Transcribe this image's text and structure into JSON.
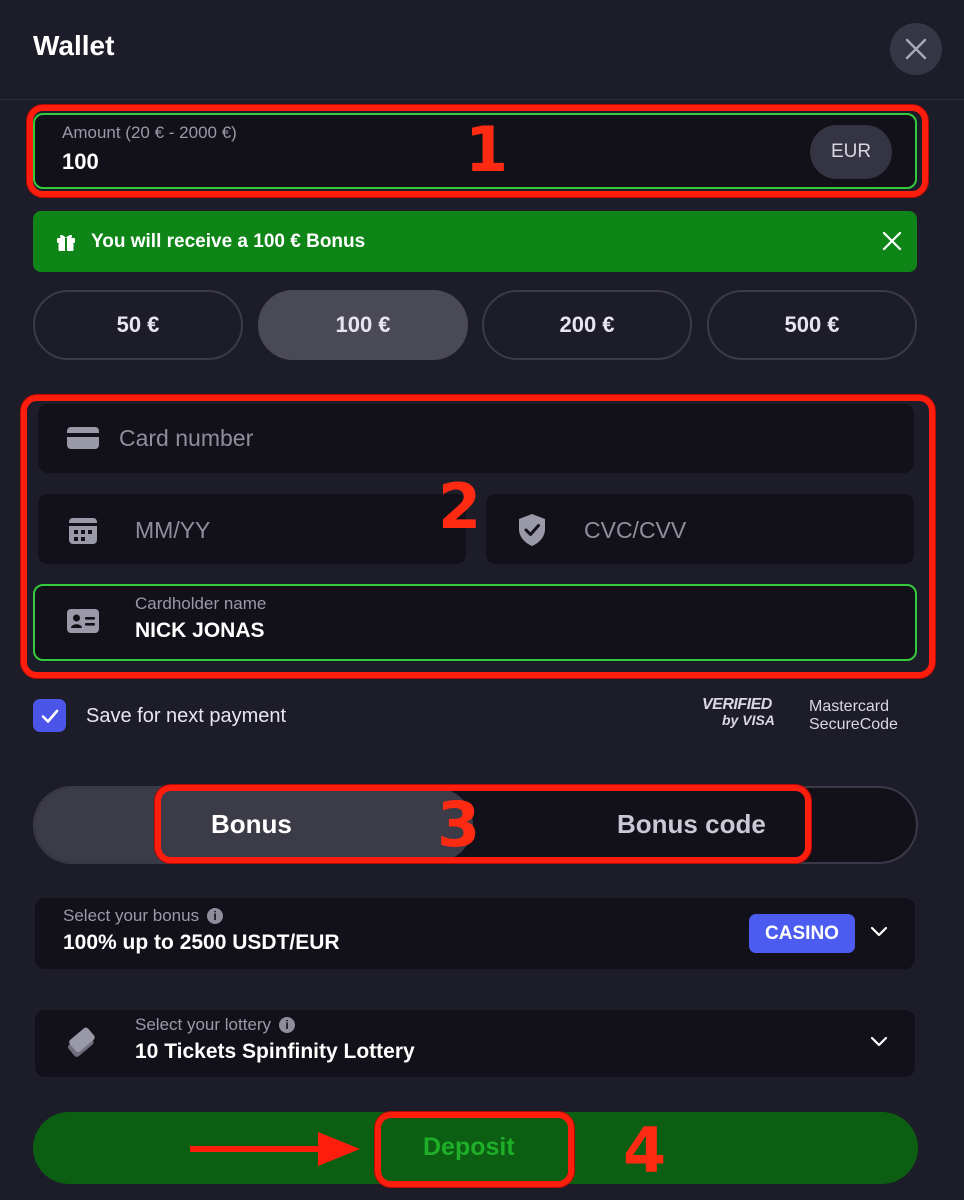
{
  "header": {
    "title": "Wallet"
  },
  "amount": {
    "label": "Amount (20 € - 2000 €)",
    "value": "100",
    "currency": "EUR"
  },
  "bonus_banner": {
    "text": "You will receive a 100 € Bonus"
  },
  "presets": [
    {
      "label": "50 €",
      "selected": false
    },
    {
      "label": "100 €",
      "selected": true
    },
    {
      "label": "200 €",
      "selected": false
    },
    {
      "label": "500 €",
      "selected": false
    }
  ],
  "card": {
    "number_placeholder": "Card number",
    "expiry_placeholder": "MM/YY",
    "cvc_placeholder": "CVC/CVV",
    "holder_label": "Cardholder name",
    "holder_value": "NICK JONAS"
  },
  "save": {
    "label": "Save for next payment",
    "checked": true
  },
  "security_logos": {
    "visa_line1": "VERIFIED",
    "visa_line2": "by VISA",
    "mc_line1": "Mastercard",
    "mc_line2": "SecureCode"
  },
  "tabs": [
    {
      "label": "Bonus",
      "active": true
    },
    {
      "label": "Bonus code",
      "active": false
    }
  ],
  "bonus_select": {
    "label": "Select your bonus",
    "value": "100% up to 2500 USDT/EUR",
    "badge": "CASINO"
  },
  "lottery_select": {
    "label": "Select your lottery",
    "value": "10 Tickets Spinfinity Lottery"
  },
  "deposit": {
    "label": "Deposit"
  },
  "annotations": [
    "1",
    "2",
    "3",
    "4"
  ],
  "colors": {
    "background": "#1d1c29",
    "field": "#121119",
    "success": "#35c93c",
    "banner": "#0f8518",
    "accent": "#4d5cf0",
    "annotation": "#ff1e0e",
    "deposit": "#0c5e13"
  },
  "icons": [
    "close-icon",
    "gift-icon",
    "credit-card-icon",
    "calendar-icon",
    "shield-check-icon",
    "id-card-icon",
    "checkmark-icon",
    "info-icon",
    "chevron-down-icon",
    "tickets-icon",
    "arrow-right-icon"
  ]
}
